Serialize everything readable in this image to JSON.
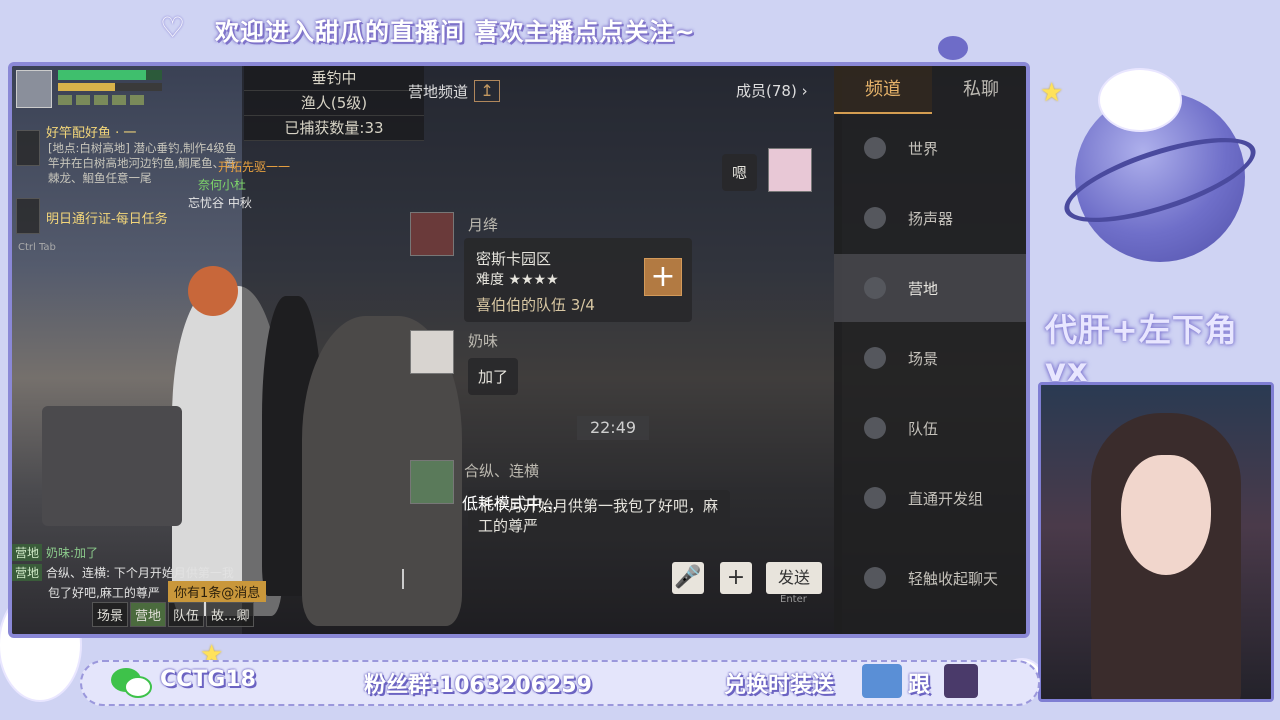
{
  "overlay": {
    "banner": "欢迎进入甜瓜的直播间 喜欢主播点点关注~",
    "ad_text": "代肝+左下角vx",
    "bottom_wechat": "CCTG18",
    "bottom_fans": "粉丝群:1063206259",
    "bottom_exchange": "兑换时装送",
    "bottom_follow": "跟"
  },
  "game": {
    "status": [
      "垂钓中",
      "渔人(5级)",
      "已捕获数量:33"
    ],
    "quest": {
      "title": "好竿配好鱼 · 一",
      "body": "[地点:白树高地] 潜心垂钓,制作4级鱼竿并在白树高地河边钓鱼,鲷尾鱼、蔷棘龙、鮰鱼任意一尾",
      "title2": "明日通行证-每日任务"
    },
    "overhead": {
      "pioneer": "开拓先驱一一",
      "name1": "奈何小杜",
      "name2": "忘忧谷 中秋"
    },
    "mini_chat": [
      {
        "tag": "营地",
        "text": "奶味:加了"
      },
      {
        "tag": "营地",
        "text": "合纵、连横: 下个月开始月供第一我"
      },
      {
        "tag": "",
        "text": "包了好吧,麻工的尊严"
      }
    ],
    "notice": "你有1条@消息",
    "mini_tabs": [
      "场景",
      "营地",
      "队伍",
      "故...卿"
    ],
    "ctrl_tab": "Ctrl Tab"
  },
  "chat": {
    "channel_label": "营地频道",
    "members": "成员(78)",
    "messages": {
      "me_text": "嗯",
      "user1_name": "月绛",
      "card_title": "密斯卡园区",
      "card_difficulty": "难度 ★★★★",
      "card_team": "喜伯伯的队伍 3/4",
      "card_add": "+",
      "user2_name": "奶味",
      "user2_text": "加了",
      "time": "22:49",
      "user3_name": "合纵、连横",
      "user3_text": "下个月开始月供第一我包了好吧，麻工的尊严"
    },
    "low_power": "低耗模式中...",
    "send_label": "发送",
    "enter_hint": "Enter",
    "plus_label": "+",
    "mic_label": "🎤"
  },
  "side": {
    "tabs": [
      "频道",
      "私聊"
    ],
    "items": [
      "世界",
      "扬声器",
      "营地",
      "场景",
      "队伍",
      "直通开发组",
      "轻触收起聊天"
    ]
  },
  "colors": {
    "accent": "#d49d51",
    "overlay_bg": "#cfd3f3",
    "frame": "#8a88d6"
  }
}
